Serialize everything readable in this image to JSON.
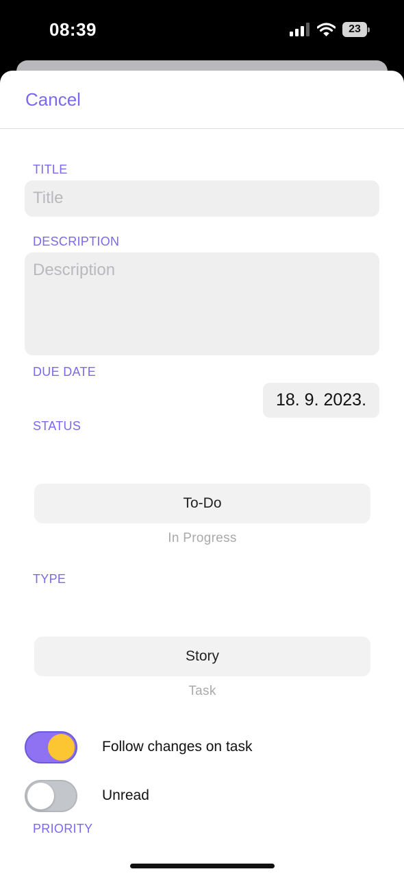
{
  "status_bar": {
    "time": "08:39",
    "battery": "23",
    "signal_icon": "cellular-signal-icon",
    "wifi_icon": "wifi-icon",
    "battery_icon": "battery-icon"
  },
  "nav": {
    "cancel_label": "Cancel"
  },
  "form": {
    "title": {
      "label": "TITLE",
      "placeholder": "Title",
      "value": ""
    },
    "description": {
      "label": "DESCRIPTION",
      "placeholder": "Description",
      "value": ""
    },
    "due_date": {
      "label": "DUE DATE",
      "value": "18. 9. 2023."
    },
    "status": {
      "label": "STATUS",
      "selected": "To-Do",
      "next_option": "In Progress"
    },
    "type": {
      "label": "TYPE",
      "selected": "Story",
      "next_option": "Task"
    },
    "toggles": [
      {
        "label": "Follow changes on task",
        "on": true
      },
      {
        "label": "Unread",
        "on": false
      }
    ],
    "priority": {
      "label": "PRIORITY"
    }
  },
  "colors": {
    "accent": "#7a68ee",
    "toggle_on_track": "#8e72f2",
    "toggle_on_knob": "#fcc532",
    "toggle_off_track": "#c3c6cb",
    "field_background": "#efeff0"
  }
}
